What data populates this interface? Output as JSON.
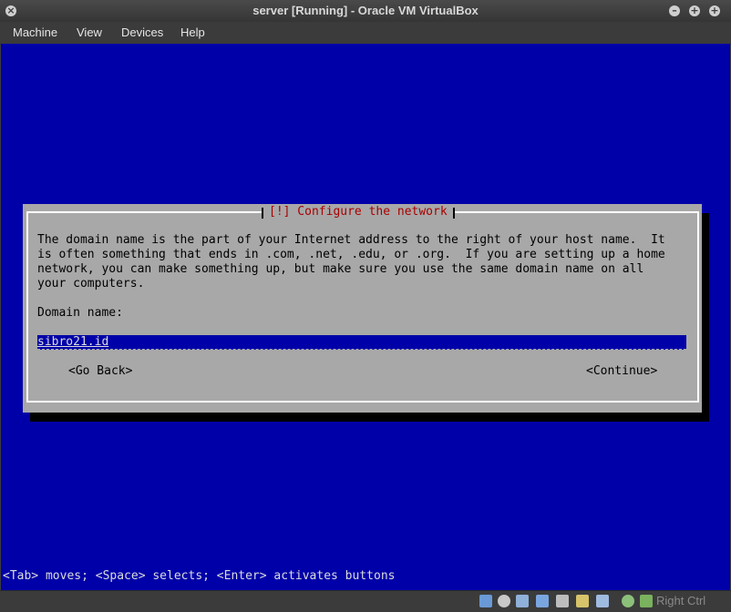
{
  "window": {
    "title": "server [Running] - Oracle VM VirtualBox",
    "controls": {
      "close": "×",
      "minimize": "–",
      "maximize": "+",
      "restore": "+"
    }
  },
  "menubar": {
    "items": [
      "Machine",
      "View",
      "Devices",
      "Help"
    ]
  },
  "installer": {
    "dialog_title": "[!] Configure the network",
    "description": "The domain name is the part of your Internet address to the right of your host name.  It\nis often something that ends in .com, .net, .edu, or .org.  If you are setting up a home\nnetwork, you can make something up, but make sure you use the same domain name on all\nyour computers.",
    "field_label": "Domain name:",
    "field_value": "sibro21.id",
    "go_back_label": "<Go Back>",
    "continue_label": "<Continue>",
    "help_line": "<Tab> moves; <Space> selects; <Enter> activates buttons"
  },
  "statusbar": {
    "host_key_label": "Right Ctrl",
    "icons": [
      "hard-disk-icon",
      "optical-drive-icon",
      "audio-icon",
      "network-icon",
      "usb-icon",
      "shared-folders-icon",
      "video-capture-icon",
      "mouse-integration-icon",
      "keyboard-capture-icon"
    ]
  },
  "colors": {
    "console_background": "#0000a8",
    "dialog_background": "#a8a8a8",
    "dialog_title_text": "#a80000"
  }
}
